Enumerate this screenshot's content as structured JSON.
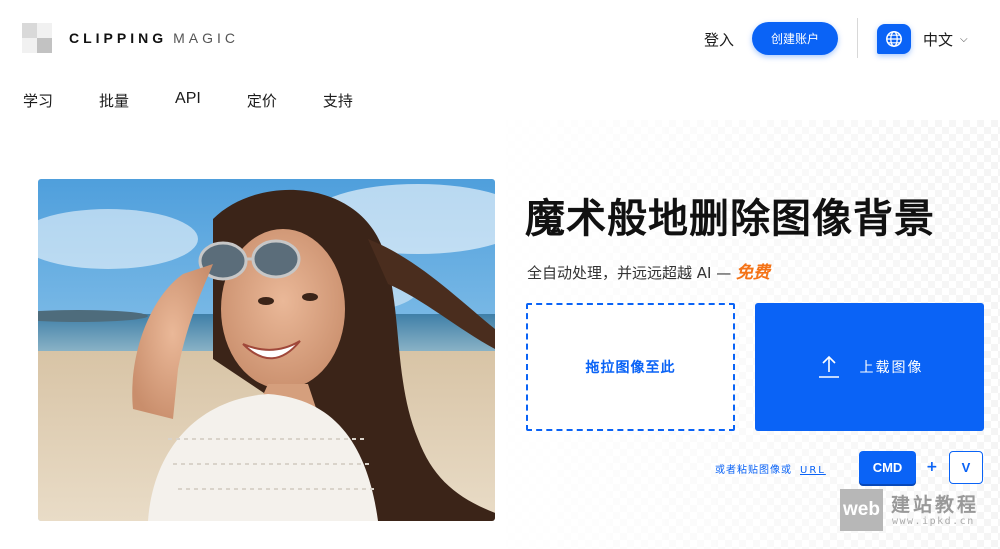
{
  "header": {
    "logo_word1": "CLIPPING",
    "logo_word2": "MAGIC",
    "login_label": "登入",
    "create_account_label": "创建账户",
    "language_label": "中文",
    "icons": {
      "language": "globe-icon",
      "dropdown": "chevron-down-icon"
    }
  },
  "nav": {
    "items": [
      {
        "label": "学习"
      },
      {
        "label": "批量"
      },
      {
        "label": "API"
      },
      {
        "label": "定价"
      },
      {
        "label": "支持"
      }
    ]
  },
  "hero": {
    "headline": "魔术般地删除图像背景",
    "subline": "全自动处理，并远远超越 AI —",
    "subline_highlight": "免费",
    "drop_zone_label": "拖拉图像至此",
    "upload_label": "上载图像",
    "upload_icon": "upload-arrow-icon",
    "paste_hint": "或者粘贴图像或",
    "paste_url_label": "URL",
    "key_cmd": "CMD",
    "key_plus": "+",
    "key_v": "V",
    "photo_icon": "woman-on-beach-photo"
  },
  "watermark": {
    "badge": "web",
    "title": "建站教程",
    "url": "www.ipkd.cn"
  },
  "colors": {
    "accent": "#0a63f6",
    "free_highlight": "#f47216"
  }
}
